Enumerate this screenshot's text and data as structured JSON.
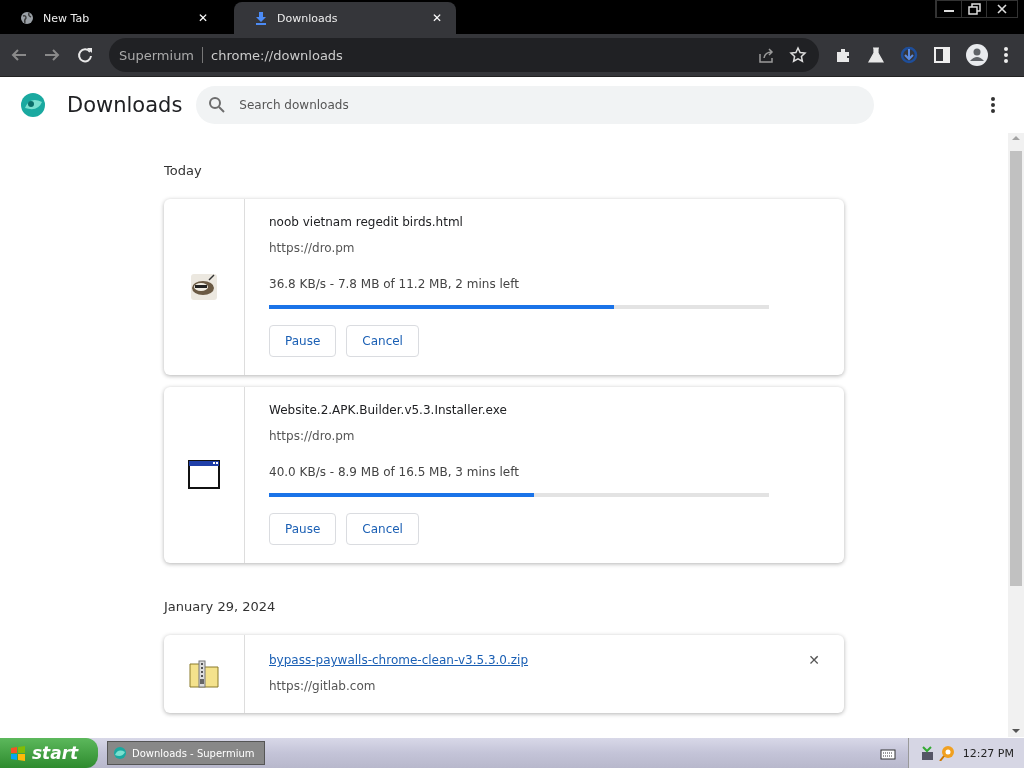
{
  "tabs": [
    {
      "title": "New Tab",
      "selected": false,
      "close": "✕"
    },
    {
      "title": "Downloads",
      "selected": true,
      "close": "✕"
    }
  ],
  "toolbar": {
    "address_origin": "Supermium",
    "address_url": "chrome://downloads"
  },
  "page": {
    "title": "Downloads",
    "search": {
      "placeholder": "Search downloads"
    }
  },
  "groups": [
    {
      "date": "Today",
      "items": [
        {
          "kind": "in_progress",
          "name": "noob vietnam regedit birds.html",
          "url": "https://dro.pm",
          "status": "36.8 KB/s - 7.8 MB of 11.2 MB, 2 mins left",
          "level": 0.69,
          "buttons": [
            "Pause",
            "Cancel"
          ]
        },
        {
          "kind": "in_progress",
          "name": "Website.2.APK.Builder.v5.3.Installer.exe",
          "url": "https://dro.pm",
          "status": "40.0 KB/s - 8.9 MB of 16.5 MB, 3 mins left",
          "level": 0.53,
          "buttons": [
            "Pause",
            "Cancel"
          ]
        }
      ]
    },
    {
      "date": "January 29, 2024",
      "items": [
        {
          "kind": "completed",
          "name": "bypass-paywalls-chrome-clean-v3.5.3.0.zip",
          "url": "https://gitlab.com",
          "remove": "✕"
        }
      ]
    }
  ],
  "taskbar": {
    "start": "start",
    "tasks": [
      {
        "title": "Downloads - Supermium",
        "selected": true
      }
    ],
    "clock": "12:27 PM"
  }
}
